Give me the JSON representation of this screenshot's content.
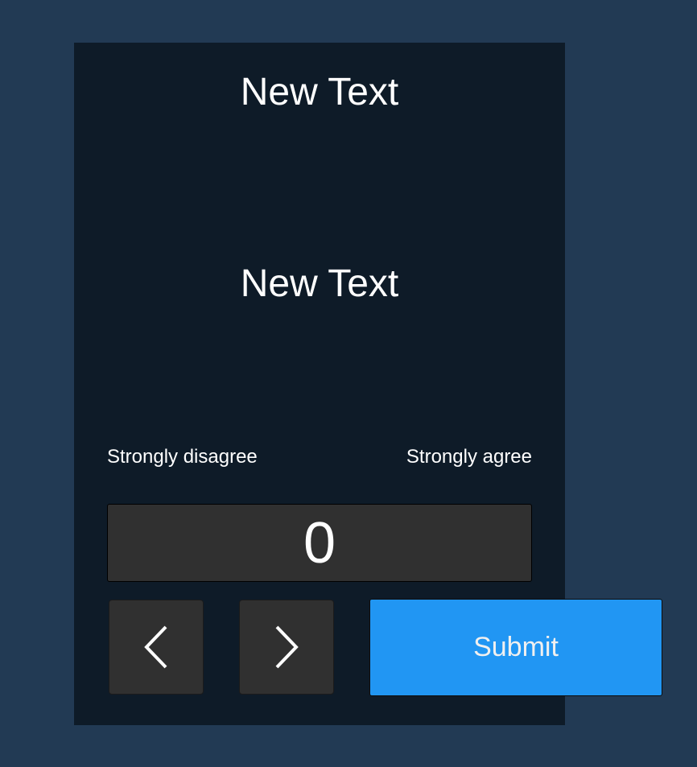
{
  "card": {
    "heading": "New Text",
    "body_text": "New Text"
  },
  "scale": {
    "min_label": "Strongly disagree",
    "max_label": "Strongly agree",
    "current_value": "0"
  },
  "controls": {
    "prev_icon": "chevron-left-icon",
    "next_icon": "chevron-right-icon",
    "submit_label": "Submit"
  },
  "colors": {
    "background": "#223a54",
    "panel": "#0e1b28",
    "control": "#303030",
    "accent": "#2196f3"
  }
}
